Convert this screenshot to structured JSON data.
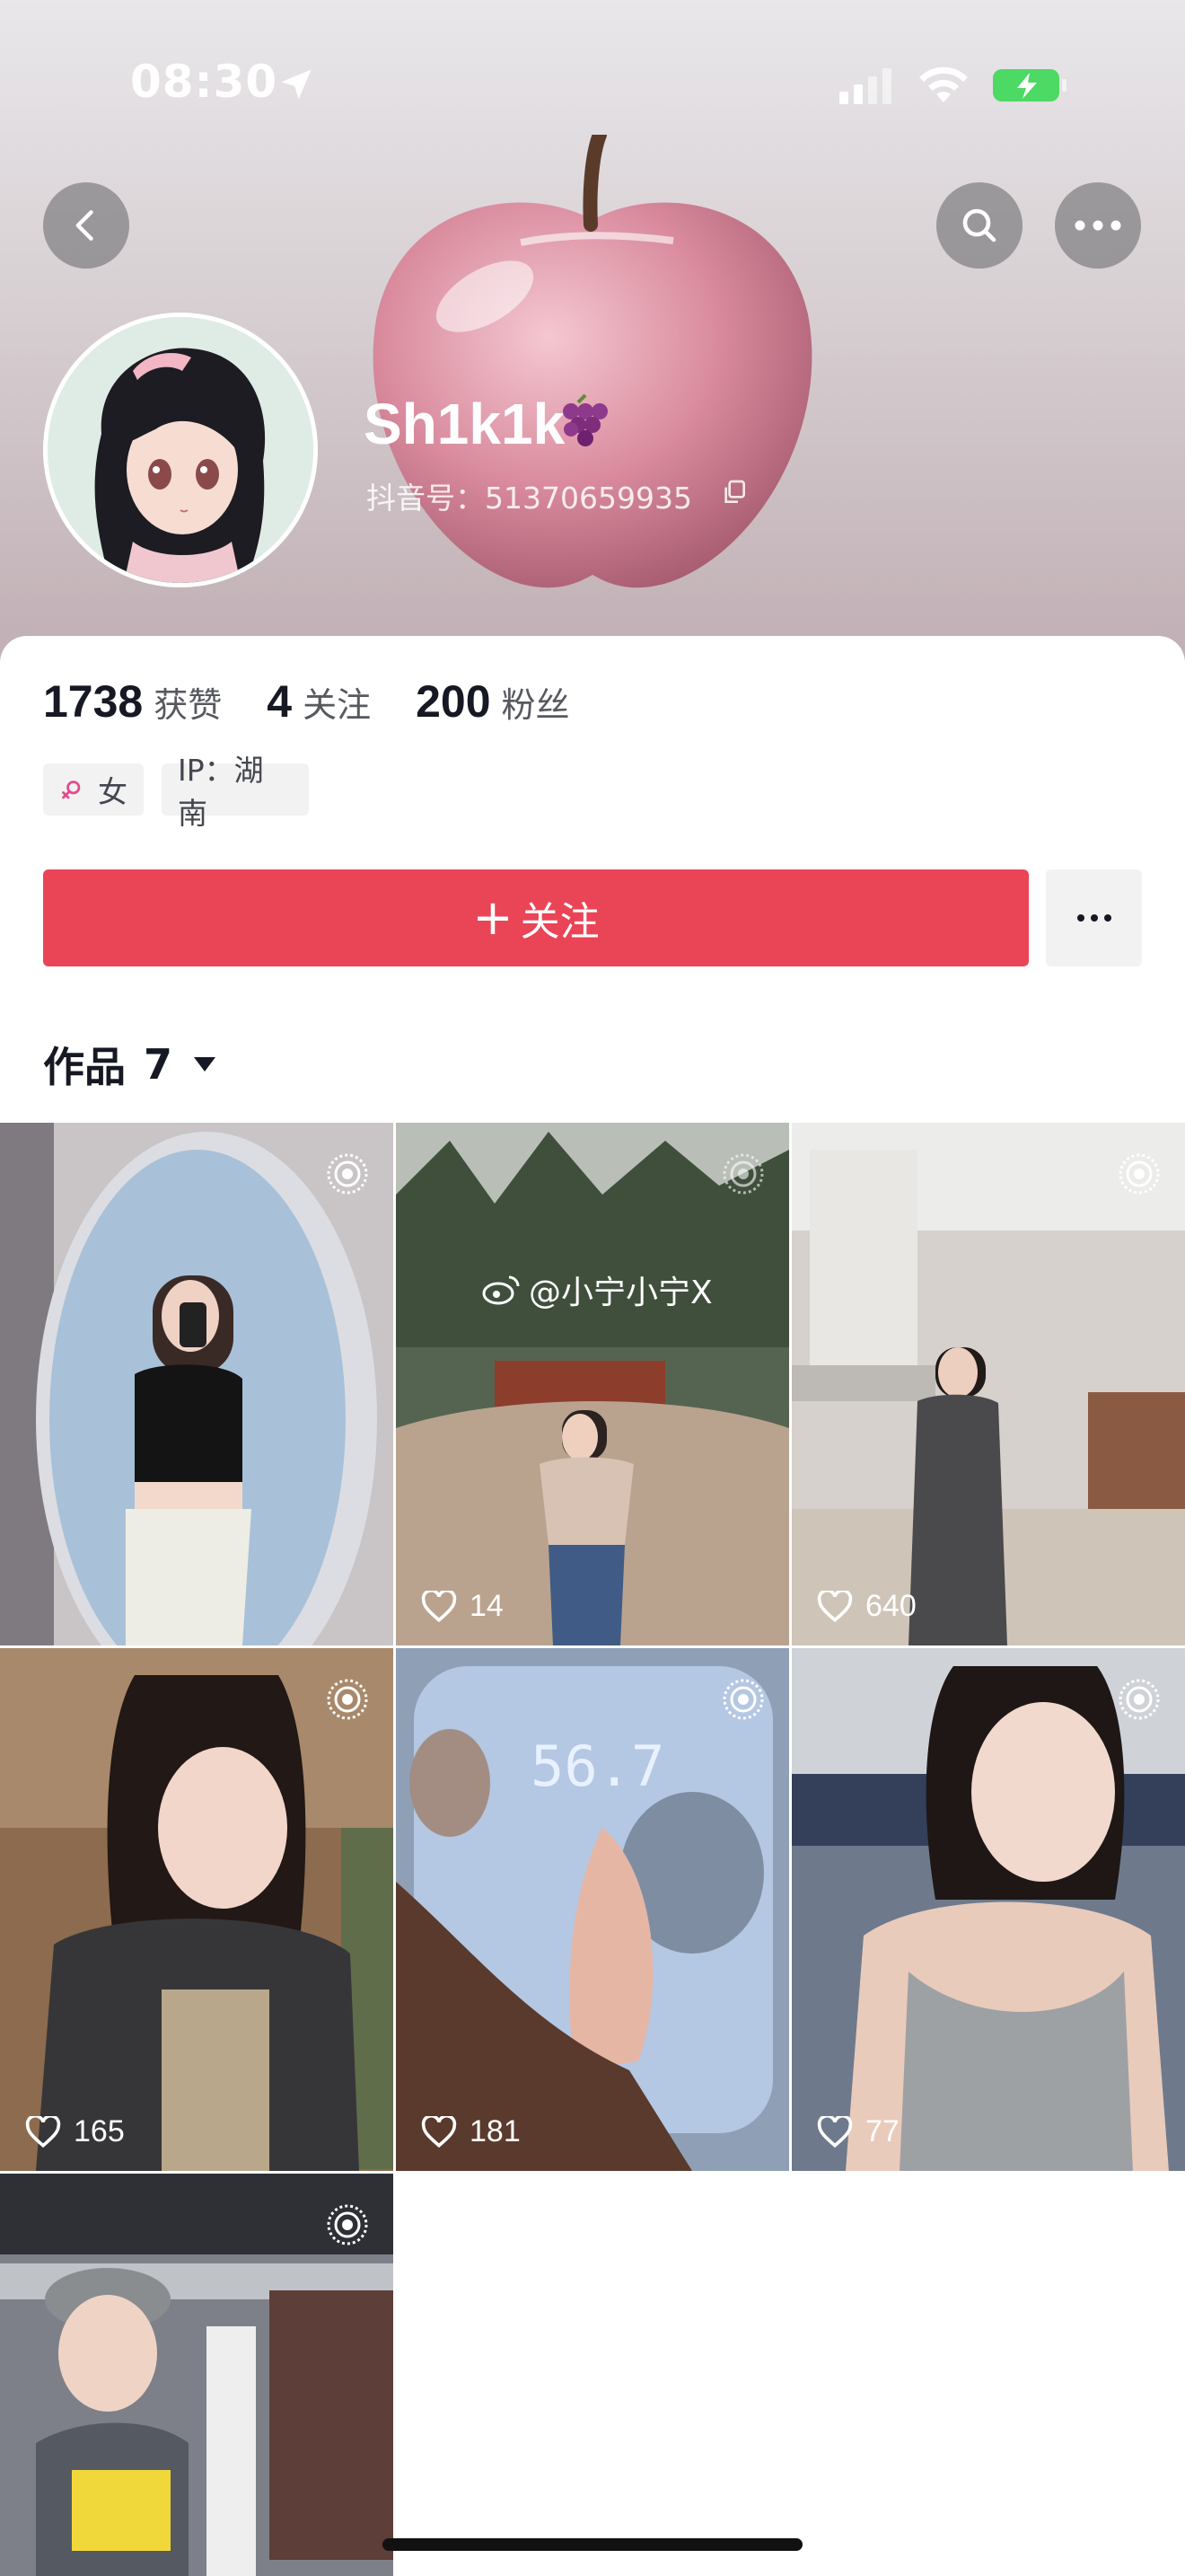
{
  "status_bar": {
    "time": "08:30",
    "icons": [
      "location-arrow-icon",
      "cellular-signal-icon",
      "wifi-icon",
      "battery-charging-icon"
    ]
  },
  "header": {
    "buttons": [
      "back-icon",
      "search-icon",
      "more-icon"
    ],
    "username": "Sh1k1k",
    "username_emoji_icon": "grapes-icon",
    "douyin_id": "抖音号：51370659935"
  },
  "stats": [
    {
      "value": "1738",
      "label": "获赞"
    },
    {
      "value": "4",
      "label": "关注"
    },
    {
      "value": "200",
      "label": "粉丝"
    }
  ],
  "tags": {
    "gender": "女",
    "ip": "IP：湖南"
  },
  "follow_button": {
    "plus": "+",
    "label": "关注"
  },
  "works_tab": {
    "label": "作品",
    "count": "7"
  },
  "videos": [
    {
      "likes": "",
      "watermark": "",
      "scene": "mirror-selfie"
    },
    {
      "likes": "14",
      "watermark": "@小宁小宁X",
      "scene": "outdoor-sand"
    },
    {
      "likes": "640",
      "watermark": "",
      "scene": "kitchen"
    },
    {
      "likes": "165",
      "watermark": "",
      "scene": "gym-jacket"
    },
    {
      "likes": "181",
      "watermark": "",
      "scene": "bathroom-scale",
      "scale_reading": "56.7"
    },
    {
      "likes": "77",
      "watermark": "",
      "scene": "gym-selfie"
    },
    {
      "likes": "",
      "watermark": "",
      "scene": "gym-cap"
    }
  ],
  "colors": {
    "accent": "#ea4457",
    "text": "#161823",
    "muted": "#57595f",
    "tag_bg": "#f2f2f3"
  }
}
